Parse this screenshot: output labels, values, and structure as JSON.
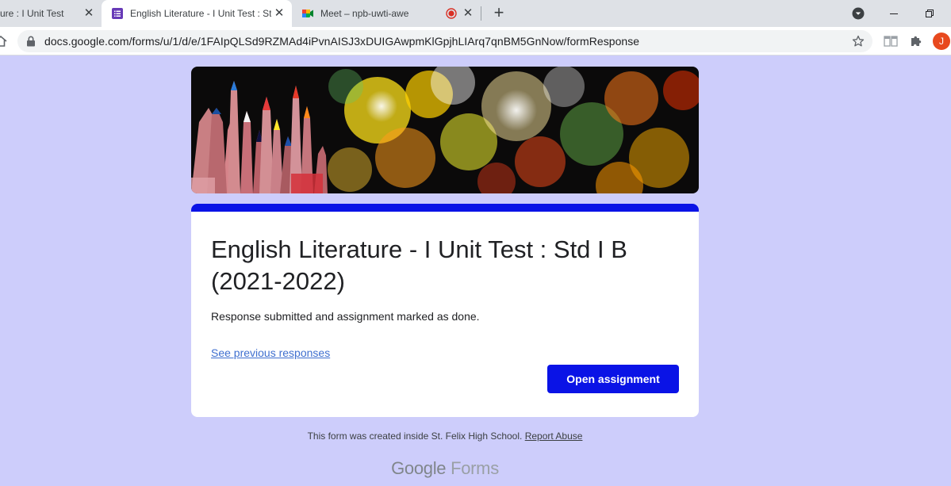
{
  "browser": {
    "tabs": [
      {
        "title": "ure : I Unit Test",
        "favicon": "forms-icon",
        "close": "✕"
      },
      {
        "title": "English Literature - I Unit Test : Std",
        "favicon": "forms-icon",
        "close": "✕",
        "active": true
      },
      {
        "title": "Meet – npb-uwti-awe",
        "favicon": "meet-icon",
        "recording": true,
        "close": "✕"
      }
    ],
    "new_tab": "+",
    "url": "docs.google.com/forms/u/1/d/e/1FAIpQLSd9RZMAd4iPvnAISJ3xDUIGAwpmKlGpjhLIArq7qnBM5GnNow/formResponse",
    "profile_initial": "J"
  },
  "form": {
    "title": "English Literature - I Unit Test : Std I B (2021-2022)",
    "confirmation": "Response submitted and assignment marked as done.",
    "previous_link": "See previous responses",
    "open_button": "Open assignment",
    "footer_text": "This form was created inside St. Felix High School.",
    "report_abuse": "Report Abuse",
    "brand_google": "Google",
    "brand_forms": "Forms"
  },
  "colors": {
    "page_bg": "#cdcdfb",
    "accent": "#0a13e6",
    "link": "#3f6fcf"
  }
}
